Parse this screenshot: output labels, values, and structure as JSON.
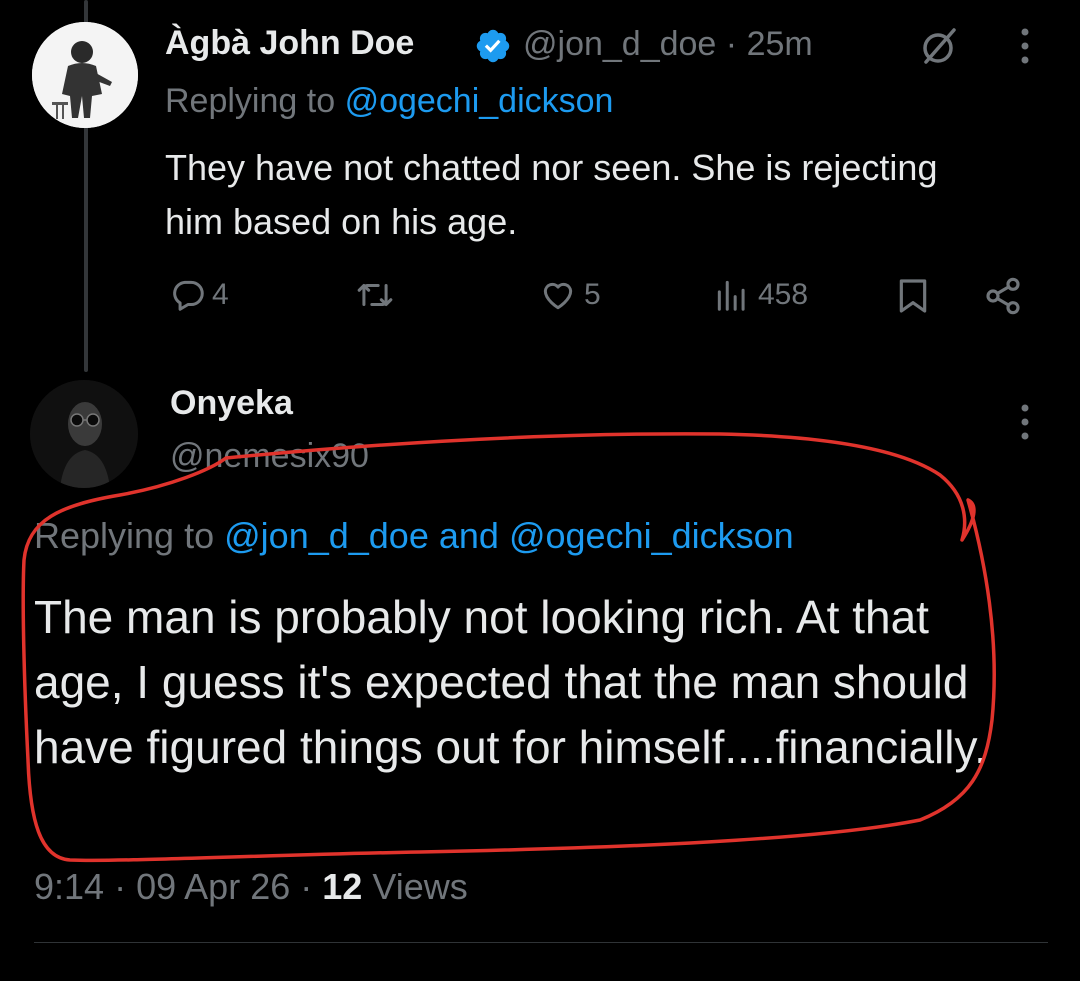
{
  "tweet1": {
    "display_name": "Àgbà John Doe",
    "handle": "@jon_d_doe",
    "separator": "·",
    "time_ago": "25m",
    "replying_prefix": "Replying to",
    "replying_to": "@ogechi_dickson",
    "text": "They have not chatted nor seen. She is rejecting him based on his age.",
    "actions": {
      "replies": "4",
      "reposts": "",
      "likes": "5",
      "views": "458"
    }
  },
  "tweet2": {
    "display_name": "Onyeka",
    "handle": "@nemesix90",
    "replying_prefix": "Replying to",
    "replying_to_1": "@jon_d_doe",
    "replying_and": "and",
    "replying_to_2": "@ogechi_dickson",
    "text": "The man is probably not looking rich. At that age, I guess it's expected that the man should have figured things out for himself....financially.",
    "footer": {
      "time": "9:14",
      "separator": "·",
      "date": "09 Apr 26",
      "views_count": "12",
      "views_label": "Views"
    }
  },
  "colors": {
    "background": "#000000",
    "text": "#e7e9ea",
    "muted": "#71767b",
    "link": "#1d9bf0",
    "verified": "#1d9bf0",
    "annotation": "#e0332c"
  },
  "icons": [
    "verified-badge-icon",
    "grok-icon",
    "more-icon",
    "reply-icon",
    "repost-icon",
    "like-icon",
    "views-icon",
    "bookmark-icon",
    "share-icon"
  ]
}
